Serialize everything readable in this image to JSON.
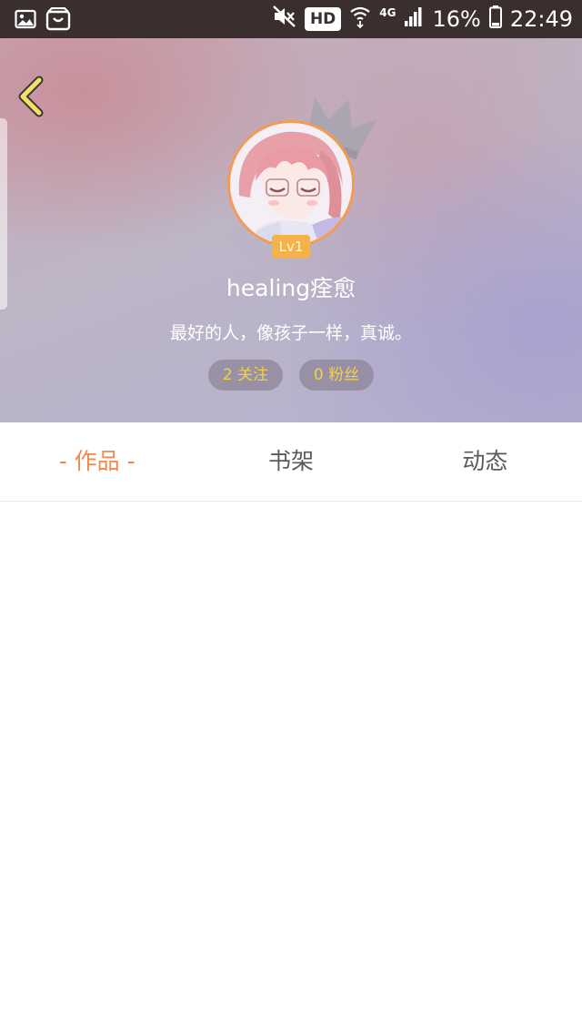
{
  "status_bar": {
    "network_label": "4G",
    "hd_label": "HD",
    "battery_percent": "16%",
    "time": "22:49",
    "icons": [
      "image-icon",
      "shop-bag-icon",
      "mute-icon",
      "hd-badge",
      "wifi-icon",
      "signal-icon",
      "battery-icon"
    ]
  },
  "header": {
    "back_icon": "chevron-left-icon",
    "level": "Lv1",
    "username": "healing痊愈",
    "bio": "最好的人，像孩子一样，真诚。",
    "stats": {
      "following": "2 关注",
      "fans": "0 粉丝"
    },
    "colors": {
      "avatar_ring": "#f39a53",
      "level_badge": "#f5b24a",
      "stat_text": "#f6d13c",
      "back_icon": "#f2e06a"
    }
  },
  "tabs": [
    {
      "label": "- 作品 -",
      "active": true
    },
    {
      "label": "书架",
      "active": false
    },
    {
      "label": "动态",
      "active": false
    }
  ],
  "colors": {
    "active_tab": "#ef8a4c",
    "inactive_tab": "#5a5a5a",
    "status_bar_bg": "#3a2e2f"
  }
}
